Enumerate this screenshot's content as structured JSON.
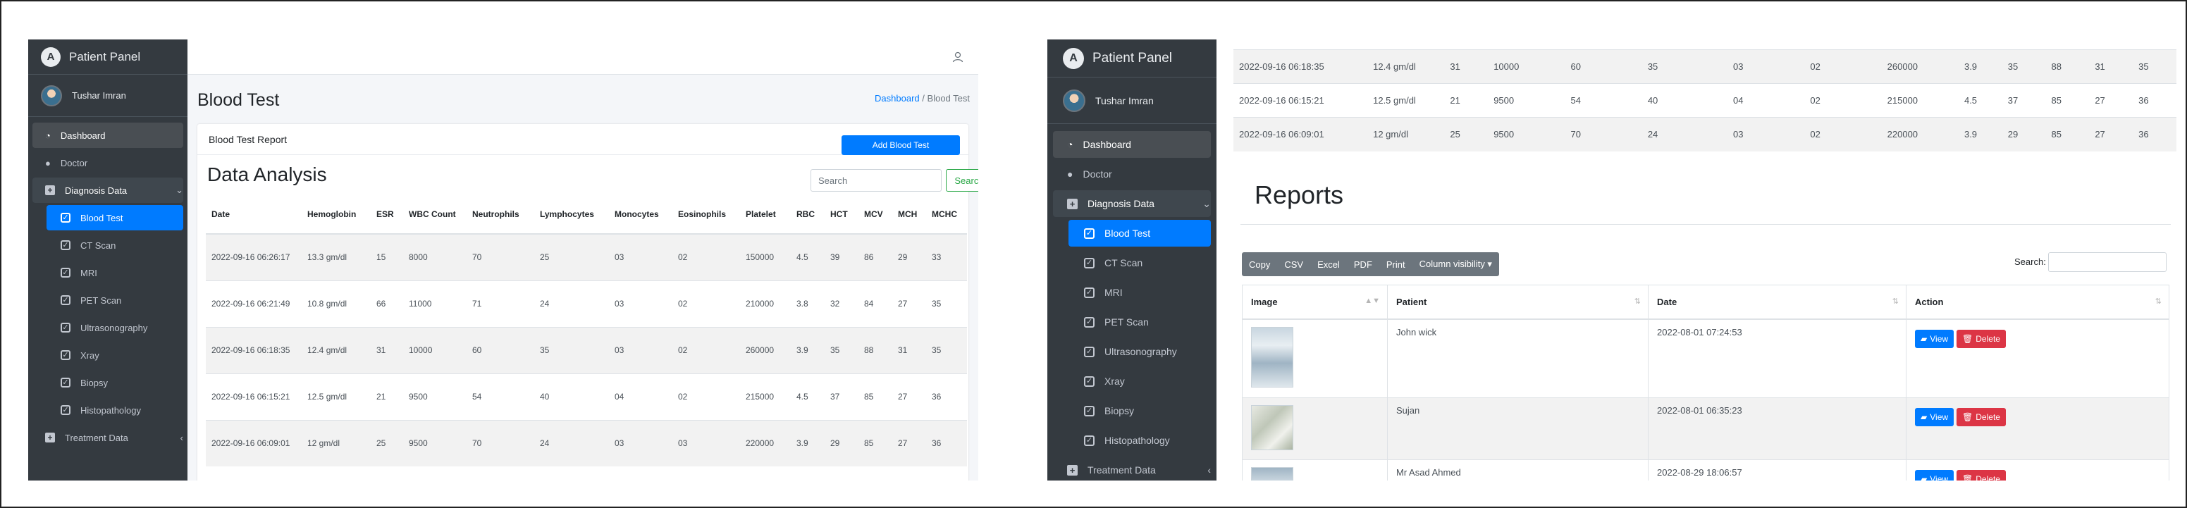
{
  "left": {
    "sidebar": {
      "brand": "Patient Panel",
      "user": "Tushar Imran",
      "items": [
        {
          "label": "Dashboard"
        },
        {
          "label": "Doctor"
        },
        {
          "label": "Diagnosis Data"
        },
        {
          "label": "Blood Test"
        },
        {
          "label": "CT Scan"
        },
        {
          "label": "MRI"
        },
        {
          "label": "PET Scan"
        },
        {
          "label": "Ultrasonography"
        },
        {
          "label": "Xray"
        },
        {
          "label": "Biopsy"
        },
        {
          "label": "Histopathology"
        },
        {
          "label": "Treatment Data"
        }
      ]
    },
    "page_title": "Blood Test",
    "breadcrumb": {
      "link": "Dashboard",
      "sep": "/",
      "current": "Blood Test"
    },
    "card_title": "Blood Test Report",
    "add_button": "Add Blood Test",
    "analysis_title": "Data Analysis",
    "search_placeholder": "Search",
    "search_button": "Search",
    "table": {
      "headers": [
        "Date",
        "Hemoglobin",
        "ESR",
        "WBC Count",
        "Neutrophils",
        "Lymphocytes",
        "Monocytes",
        "Eosinophils",
        "Platelet",
        "RBC",
        "HCT",
        "MCV",
        "MCH",
        "MCHC"
      ],
      "rows": [
        [
          "2022-09-16 06:26:17",
          "13.3 gm/dl",
          "15",
          "8000",
          "70",
          "25",
          "03",
          "02",
          "150000",
          "4.5",
          "39",
          "86",
          "29",
          "33"
        ],
        [
          "2022-09-16 06:21:49",
          "10.8 gm/dl",
          "66",
          "11000",
          "71",
          "24",
          "03",
          "02",
          "210000",
          "3.8",
          "32",
          "84",
          "27",
          "35"
        ],
        [
          "2022-09-16 06:18:35",
          "12.4 gm/dl",
          "31",
          "10000",
          "60",
          "35",
          "03",
          "02",
          "260000",
          "3.9",
          "35",
          "88",
          "31",
          "35"
        ],
        [
          "2022-09-16 06:15:21",
          "12.5 gm/dl",
          "21",
          "9500",
          "54",
          "40",
          "04",
          "02",
          "215000",
          "4.5",
          "37",
          "85",
          "27",
          "36"
        ],
        [
          "2022-09-16 06:09:01",
          "12 gm/dl",
          "25",
          "9500",
          "70",
          "24",
          "03",
          "03",
          "220000",
          "3.9",
          "29",
          "85",
          "27",
          "36"
        ]
      ]
    }
  },
  "right": {
    "sidebar": {
      "brand": "Patient Panel",
      "user": "Tushar Imran",
      "items": [
        {
          "label": "Dashboard"
        },
        {
          "label": "Doctor"
        },
        {
          "label": "Diagnosis Data"
        },
        {
          "label": "Blood Test"
        },
        {
          "label": "CT Scan"
        },
        {
          "label": "MRI"
        },
        {
          "label": "PET Scan"
        },
        {
          "label": "Ultrasonography"
        },
        {
          "label": "Xray"
        },
        {
          "label": "Biopsy"
        },
        {
          "label": "Histopathology"
        },
        {
          "label": "Treatment Data"
        }
      ]
    },
    "table": {
      "rows": [
        [
          "2022-09-16 06:18:35",
          "12.4 gm/dl",
          "31",
          "10000",
          "60",
          "35",
          "03",
          "02",
          "260000",
          "3.9",
          "35",
          "88",
          "31",
          "35"
        ],
        [
          "2022-09-16 06:15:21",
          "12.5 gm/dl",
          "21",
          "9500",
          "54",
          "40",
          "04",
          "02",
          "215000",
          "4.5",
          "37",
          "85",
          "27",
          "36"
        ],
        [
          "2022-09-16 06:09:01",
          "12 gm/dl",
          "25",
          "9500",
          "70",
          "24",
          "03",
          "02",
          "220000",
          "3.9",
          "29",
          "85",
          "27",
          "36"
        ]
      ]
    },
    "reports_title": "Reports",
    "buttons": [
      "Copy",
      "CSV",
      "Excel",
      "PDF",
      "Print",
      "Column visibility ▾"
    ],
    "search_label": "Search:",
    "reports": {
      "headers": [
        "Image",
        "Patient",
        "Date",
        "Action"
      ],
      "rows": [
        {
          "patient": "John wick",
          "date": "2022-08-01 07:24:53"
        },
        {
          "patient": "Sujan",
          "date": "2022-08-01 06:35:23"
        },
        {
          "patient": "Mr Asad Ahmed",
          "date": "2022-08-29 18:06:57"
        }
      ],
      "view_label": "View",
      "delete_label": "Delete"
    }
  },
  "colors": {
    "sidebar": "#343a40",
    "primary": "#007bff",
    "danger": "#dc3545",
    "success": "#28a745",
    "content_bg": "#f4f6f9"
  }
}
